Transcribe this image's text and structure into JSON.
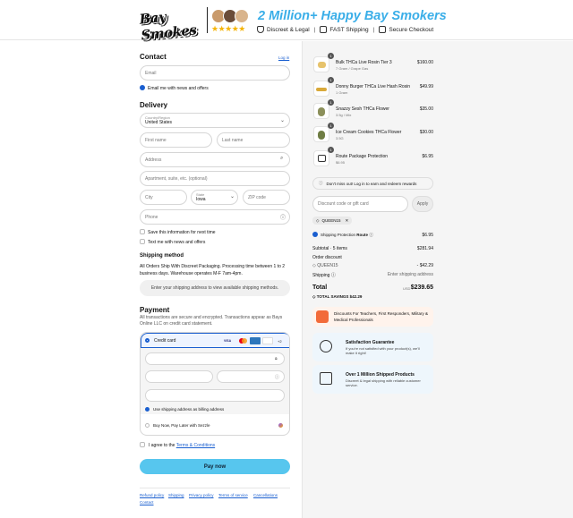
{
  "header": {
    "logo": "Bay Smokes",
    "tagline": "2 Million+ Happy Bay Smokers",
    "stars": "★★★★★",
    "badges": [
      "Discreet & Legal",
      "FAST Shipping",
      "Secure Checkout"
    ]
  },
  "contact": {
    "title": "Contact",
    "login": "Log in",
    "email_placeholder": "Email",
    "email_opt": "Email me with news and offers"
  },
  "delivery": {
    "title": "Delivery",
    "country_label": "Country/Region",
    "country_value": "United States",
    "first_name": "First name",
    "last_name": "Last name",
    "address": "Address",
    "apartment": "Apartment, suite, etc. (optional)",
    "city": "City",
    "state_label": "State",
    "state_value": "Iowa",
    "zip": "ZIP code",
    "phone": "Phone",
    "save_info": "Save this information for next time",
    "text_opt": "Text me with news and offers"
  },
  "shipping": {
    "title": "Shipping method",
    "desc": "All Orders Ship With Discreet Packaging. Processing time between 1 to 2 business days. Warehouse operates M-F 7am-4pm.",
    "notice": "Enter your shipping address to view available shipping methods."
  },
  "payment": {
    "title": "Payment",
    "desc": "All transactions are secure and encrypted. Transactions appear as Bays Online LLC on credit card statement.",
    "credit_card": "Credit card",
    "card_brands": [
      "VISA",
      "MC",
      "AMEX",
      "DISC"
    ],
    "more_brands": "+2",
    "billing_opt": "Use shipping address as billing address",
    "sezzle": "Buy Now, Pay Later with Sezzle"
  },
  "terms": {
    "prefix": "I agree to the",
    "link": "Terms & Conditions"
  },
  "pay_button": "Pay now",
  "footer_links": [
    "Refund policy",
    "Shipping",
    "Privacy policy",
    "Terms of service",
    "Cancellations",
    "Contact"
  ],
  "order": {
    "items": [
      {
        "qty": "1",
        "name": "Bulk THCa Live Rosin Tier 3",
        "sub": "7 Gram / Grape Gas",
        "price": "$160.00"
      },
      {
        "qty": "1",
        "name": "Donny Burger THCa Live Hash Rosin",
        "sub": "1 Gram",
        "price": "$49.99"
      },
      {
        "qty": "1",
        "name": "Snazzy Sesh THCa Flower",
        "sub": "3.5g / Mix",
        "price": "$35.00"
      },
      {
        "qty": "1",
        "name": "Ice Cream Cookies THCa Flower",
        "sub": "3.5G",
        "price": "$30.00"
      },
      {
        "qty": "1",
        "name": "Route Package Protection",
        "sub": "$6.95",
        "price": "$6.95"
      }
    ],
    "login_note": "Don't miss out! Log in to earn and redeem rewards",
    "discount_placeholder": "Discount code or gift card",
    "apply": "Apply",
    "code": "QUEEN15",
    "protection_label": "Shipping Protection",
    "route": "Route",
    "protection_price": "$6.95",
    "subtotal_label": "Subtotal · 5 items",
    "subtotal": "$281.94",
    "order_discount": "Order discount",
    "discount_code": "QUEEN15",
    "discount_amount": "- $42.29",
    "shipping_label": "Shipping",
    "shipping_value": "Enter shipping address",
    "total_label": "Total",
    "currency": "USD",
    "total": "$239.65",
    "savings_label": "TOTAL SAVINGS",
    "savings": "$42.29"
  },
  "promos": [
    {
      "title": "Discounts For Teachers, First Responders, Military & Medical Professionals",
      "text": ""
    },
    {
      "title": "Satisfaction Guarantee",
      "text": "If you're not satisfied with your product(s), we'll make it right!"
    },
    {
      "title": "Over 1 Million Shipped Products",
      "text": "Discreet & legal shipping with reliable customer service."
    }
  ],
  "colors": {
    "accent": "#57c6ee",
    "brand_blue": "#3aaee8",
    "link": "#1a5fd0"
  }
}
